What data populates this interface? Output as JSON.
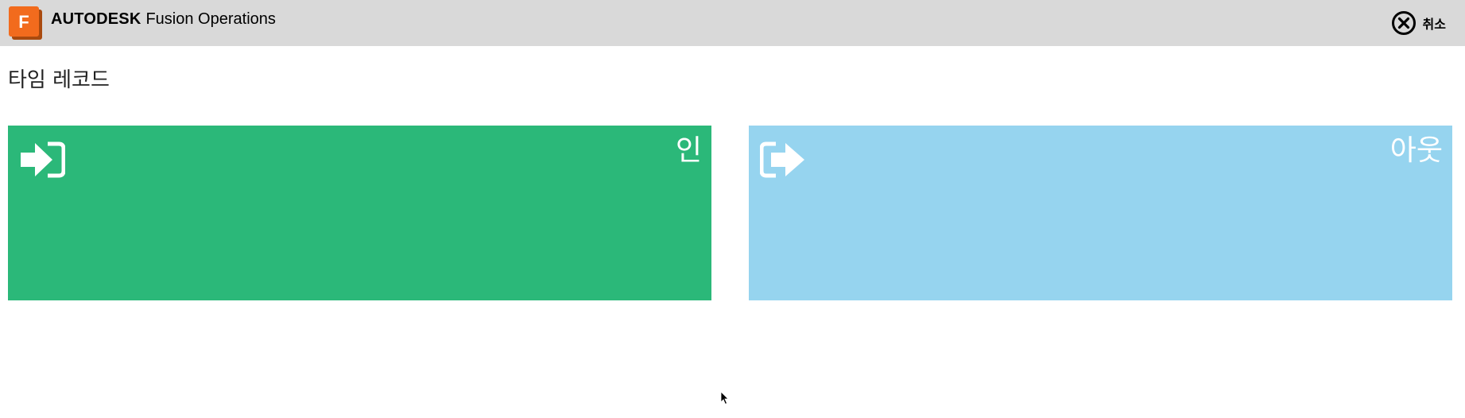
{
  "header": {
    "logo_letter": "F",
    "brand_name": "AUTODESK",
    "product_name": "Fusion Operations",
    "cancel_label": "취소",
    "cancel_icon": "close-circle-icon",
    "colors": {
      "bar": "#d9d9d9",
      "logo": "#f26b1d"
    }
  },
  "page": {
    "title": "타임 레코드"
  },
  "tiles": [
    {
      "label": "인",
      "icon": "sign-in-icon",
      "color": "#2bb879"
    },
    {
      "label": "아웃",
      "icon": "sign-out-icon",
      "color": "#96d4ef"
    }
  ]
}
